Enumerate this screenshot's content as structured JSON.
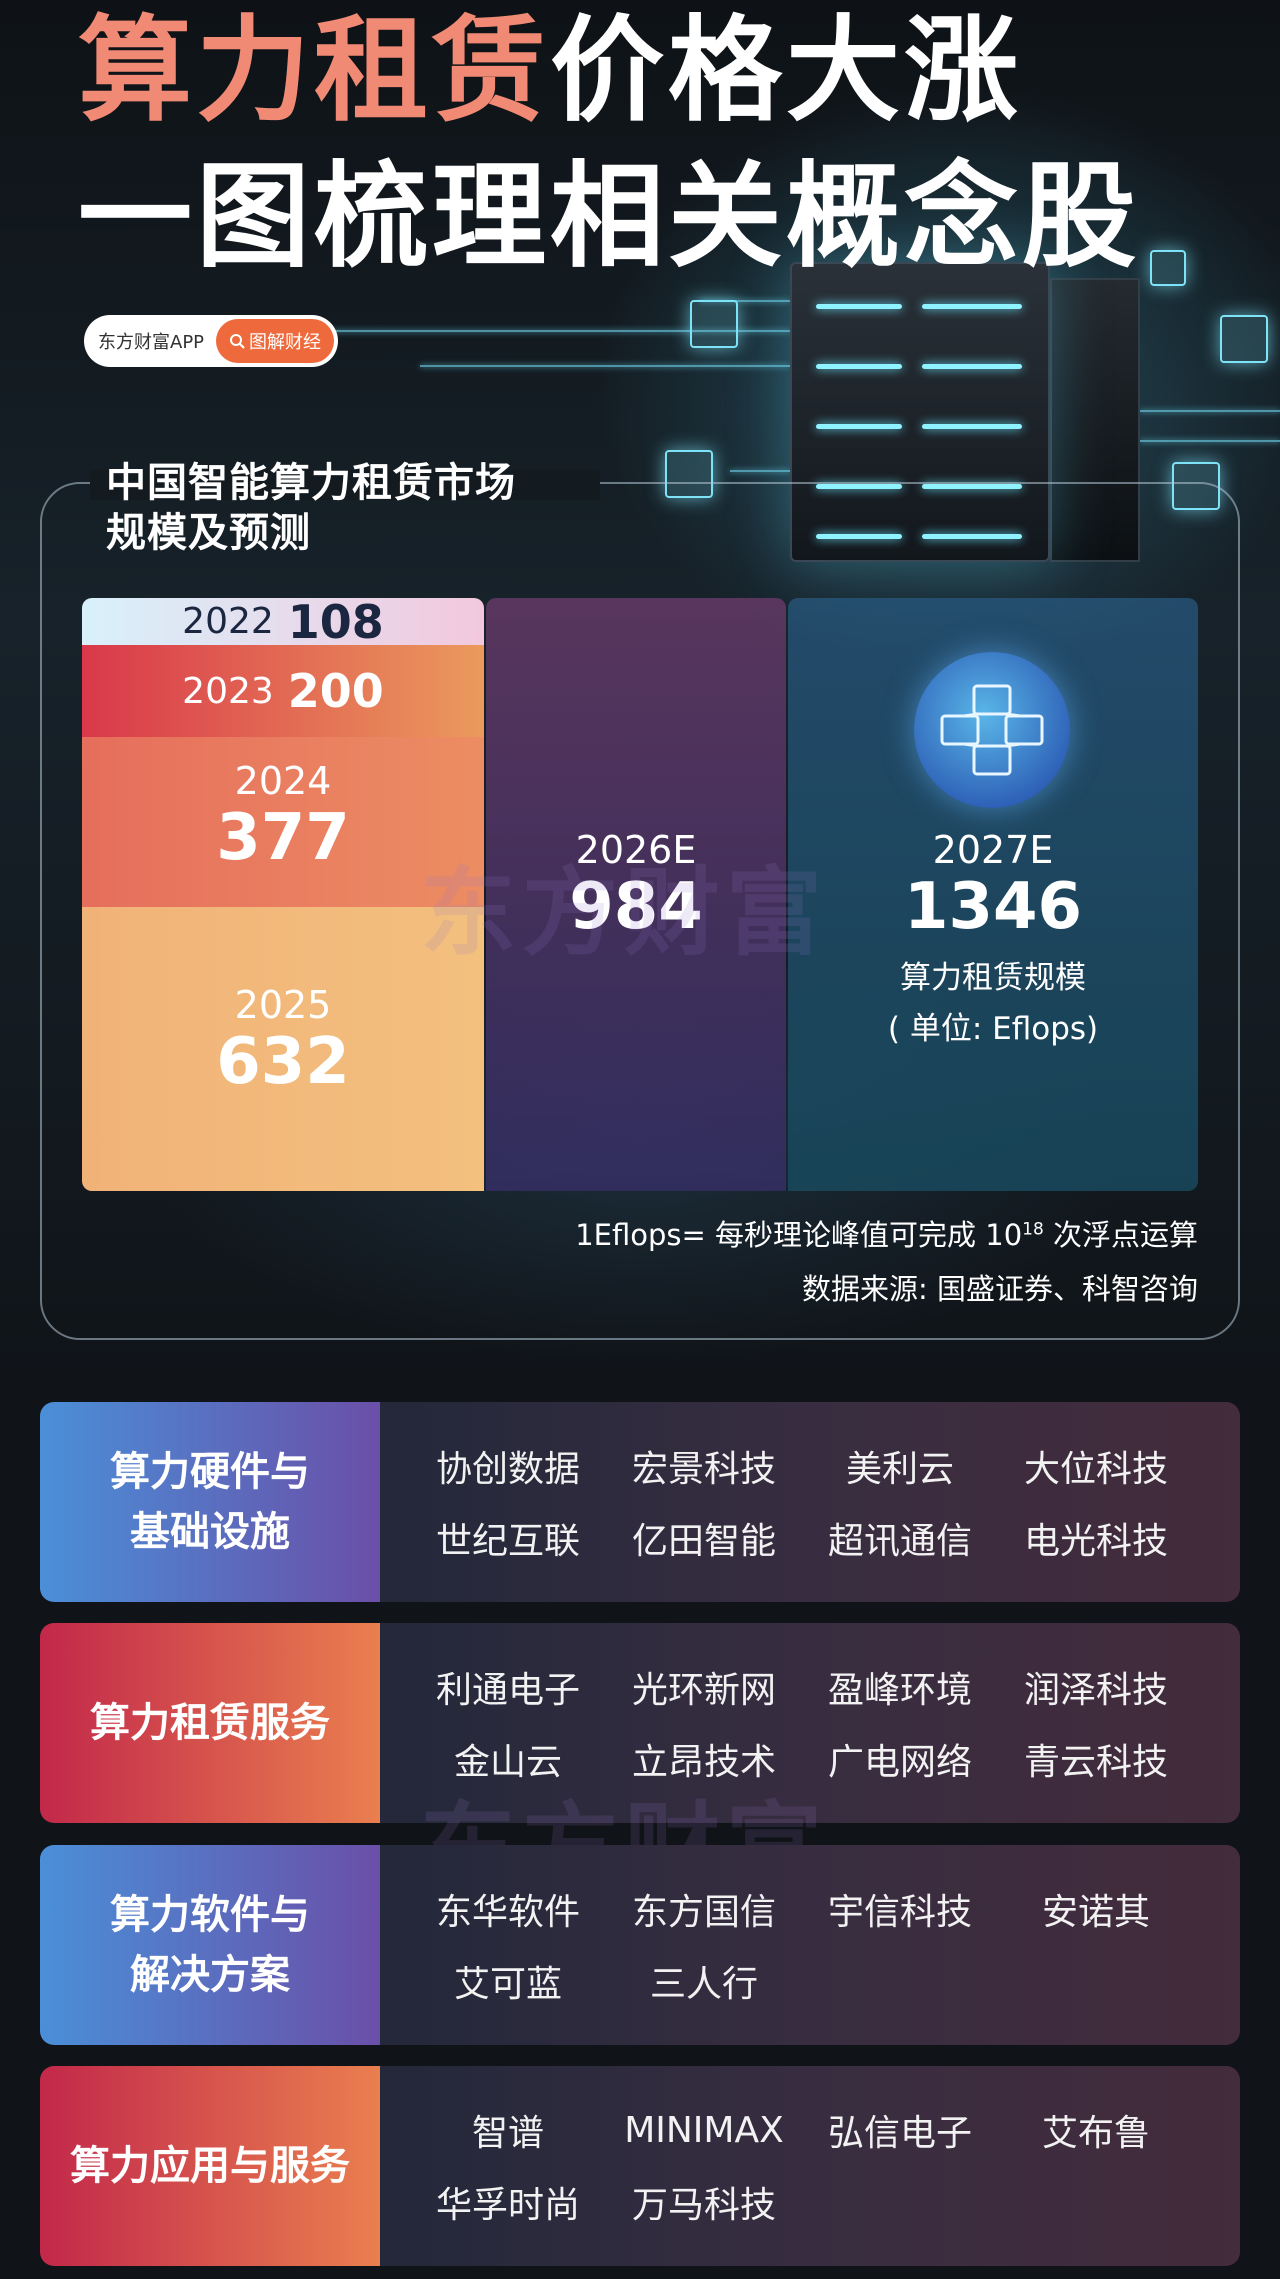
{
  "headline": {
    "line1_accent": "算力租赁",
    "line1_rest": "价格大涨",
    "line2": "一图梳理相关概念股"
  },
  "brand": {
    "app_name": "东方财富APP",
    "tag": "图解财经",
    "tag_icon": "search-icon"
  },
  "chart_data": {
    "type": "bar",
    "title_line1": "中国智能算力租赁市场",
    "title_line2": "规模及预测",
    "categories": [
      "2022",
      "2023",
      "2024",
      "2025",
      "2026E",
      "2027E"
    ],
    "values": [
      108,
      200,
      377,
      632,
      984,
      1346
    ],
    "series_label": "算力租赁规模",
    "unit": "( 单位: Eflops)",
    "footnote_prefix": "1Eflops= 每秒理论峰值可完成 10",
    "footnote_exp": "18",
    "footnote_suffix": " 次浮点运算",
    "source": "数据来源: 国盛证券、科智咨询"
  },
  "watermark": "东方财富",
  "categories": [
    {
      "label_line1": "算力硬件与",
      "label_line2": "基础设施",
      "style": "blue",
      "companies": [
        "协创数据",
        "宏景科技",
        "美利云",
        "大位科技",
        "世纪互联",
        "亿田智能",
        "超讯通信",
        "电光科技"
      ]
    },
    {
      "label_line1": "算力租赁服务",
      "label_line2": "",
      "style": "red",
      "companies": [
        "利通电子",
        "光环新网",
        "盈峰环境",
        "润泽科技",
        "金山云",
        "立昂技术",
        "广电网络",
        "青云科技"
      ]
    },
    {
      "label_line1": "算力软件与",
      "label_line2": "解决方案",
      "style": "blue",
      "companies": [
        "东华软件",
        "东方国信",
        "宇信科技",
        "安诺其",
        "艾可蓝",
        "三人行"
      ]
    },
    {
      "label_line1": "算力应用与服务",
      "label_line2": "",
      "style": "red",
      "companies": [
        "智谱",
        "MINIMAX",
        "弘信电子",
        "艾布鲁",
        "华孚时尚",
        "万马科技"
      ]
    }
  ],
  "colors": {
    "accent": "#f08a74",
    "brand_tag": "#ee6a3c",
    "background": "#101317"
  }
}
